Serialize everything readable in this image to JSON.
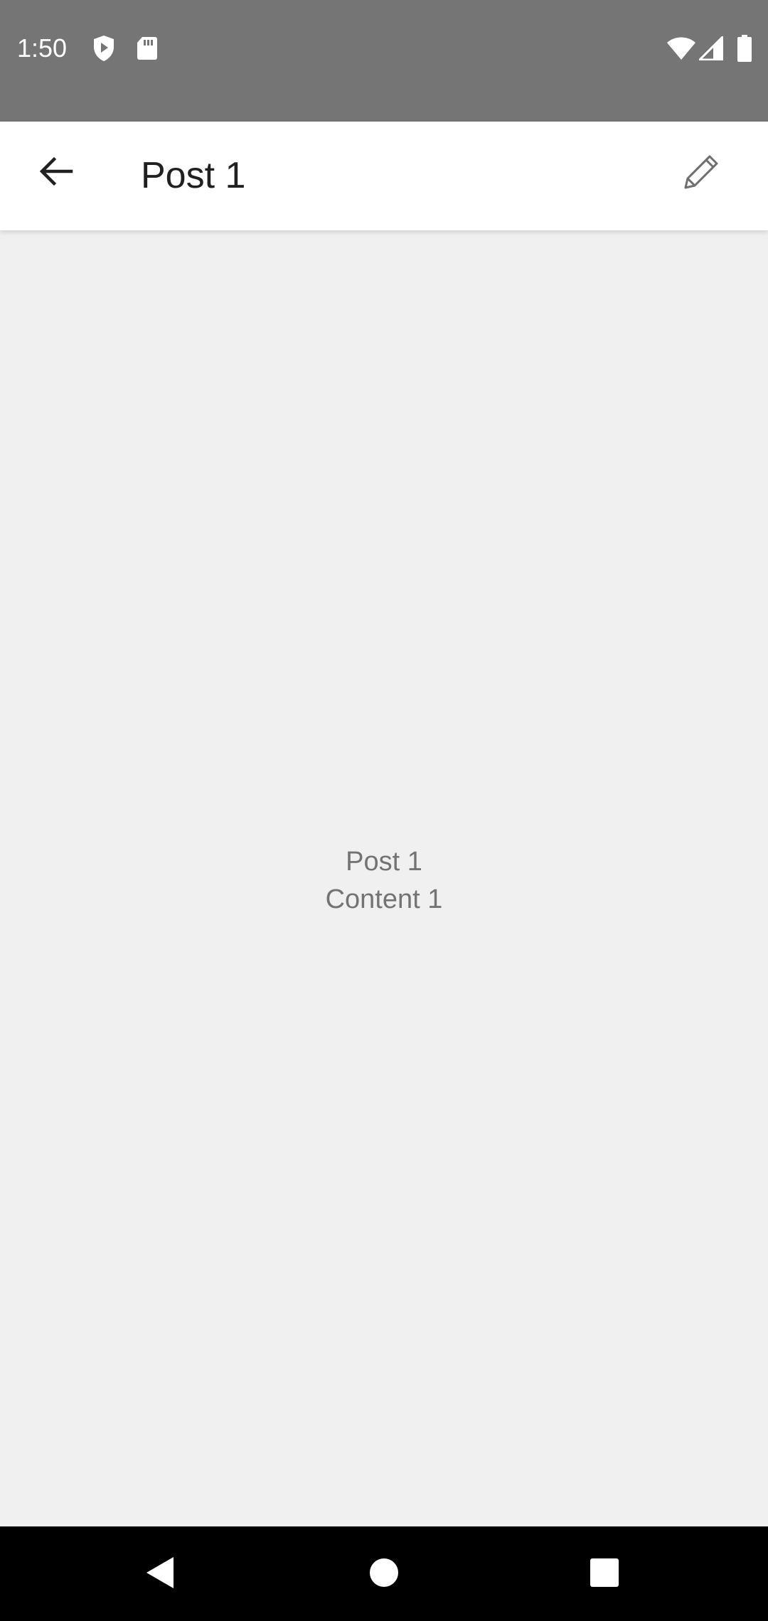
{
  "status_bar": {
    "time": "1:50",
    "icons": [
      "shield-play-icon",
      "sd-card-icon",
      "wifi-icon",
      "cell-signal-icon",
      "battery-icon"
    ]
  },
  "app_bar": {
    "title": "Post 1",
    "back_icon": "arrow-back-icon",
    "edit_icon": "pencil-icon"
  },
  "post": {
    "title": "Post 1",
    "content": "Content 1"
  },
  "nav_bar": {
    "icons": [
      "back-triangle-icon",
      "home-circle-icon",
      "recents-square-icon"
    ]
  },
  "colors": {
    "status_bar_bg": "#757575",
    "app_bar_bg": "#ffffff",
    "content_bg": "#f0f0f0",
    "nav_bar_bg": "#000000",
    "post_text": "#737373",
    "title_text": "#202020"
  }
}
